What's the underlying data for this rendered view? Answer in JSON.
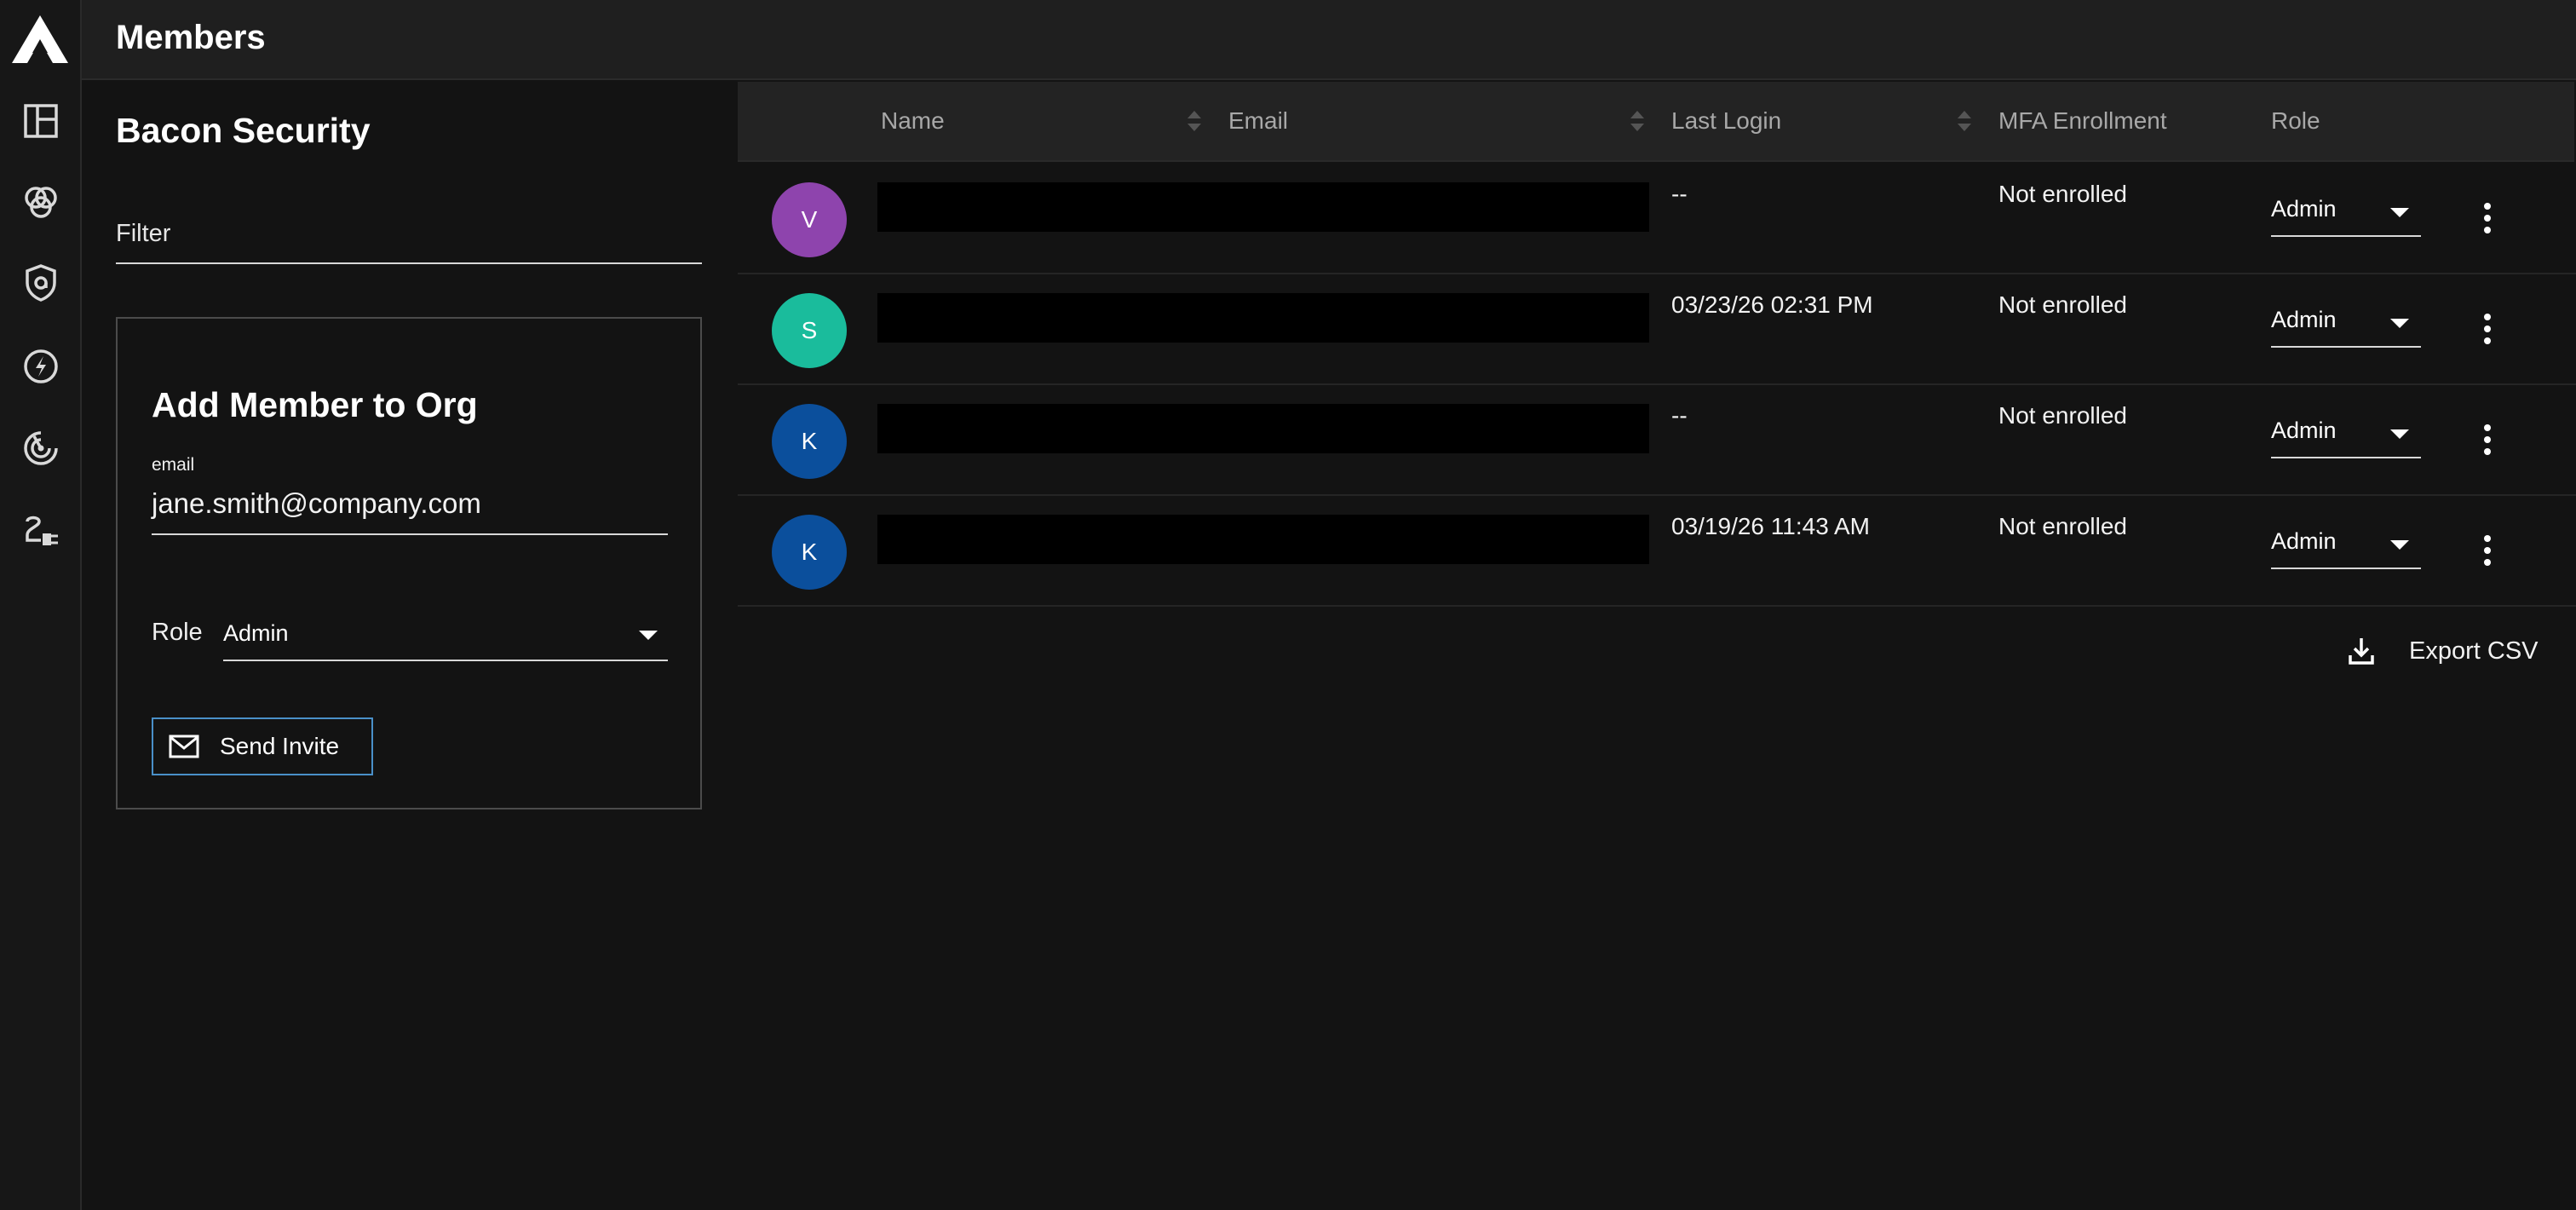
{
  "header": {
    "title": "Members"
  },
  "sidebar": {
    "icons": [
      "logo-icon",
      "layout-icon",
      "rings-icon",
      "shield-icon",
      "lightning-icon",
      "radar-icon",
      "plug-icon"
    ]
  },
  "org": {
    "name": "Bacon Security"
  },
  "filter": {
    "label": "Filter"
  },
  "add_member": {
    "title": "Add Member to Org",
    "email_label": "email",
    "email_value": "jane.smith@company.com",
    "role_label": "Role",
    "role_value": "Admin",
    "send_label": "Send Invite"
  },
  "table": {
    "columns": {
      "name": "Name",
      "email": "Email",
      "last_login": "Last Login",
      "mfa": "MFA Enrollment",
      "role": "Role"
    },
    "rows": [
      {
        "initial": "V",
        "color": "#8e44ad",
        "last_login": "--",
        "mfa": "Not enrolled",
        "role": "Admin"
      },
      {
        "initial": "S",
        "color": "#1abc9c",
        "last_login": "03/23/26 02:31 PM",
        "mfa": "Not enrolled",
        "role": "Admin"
      },
      {
        "initial": "K",
        "color": "#0b4f9c",
        "last_login": "--",
        "mfa": "Not enrolled",
        "role": "Admin"
      },
      {
        "initial": "K",
        "color": "#0b4f9c",
        "last_login": "03/19/26 11:43 AM",
        "mfa": "Not enrolled",
        "role": "Admin"
      }
    ]
  },
  "export": {
    "label": "Export CSV"
  }
}
